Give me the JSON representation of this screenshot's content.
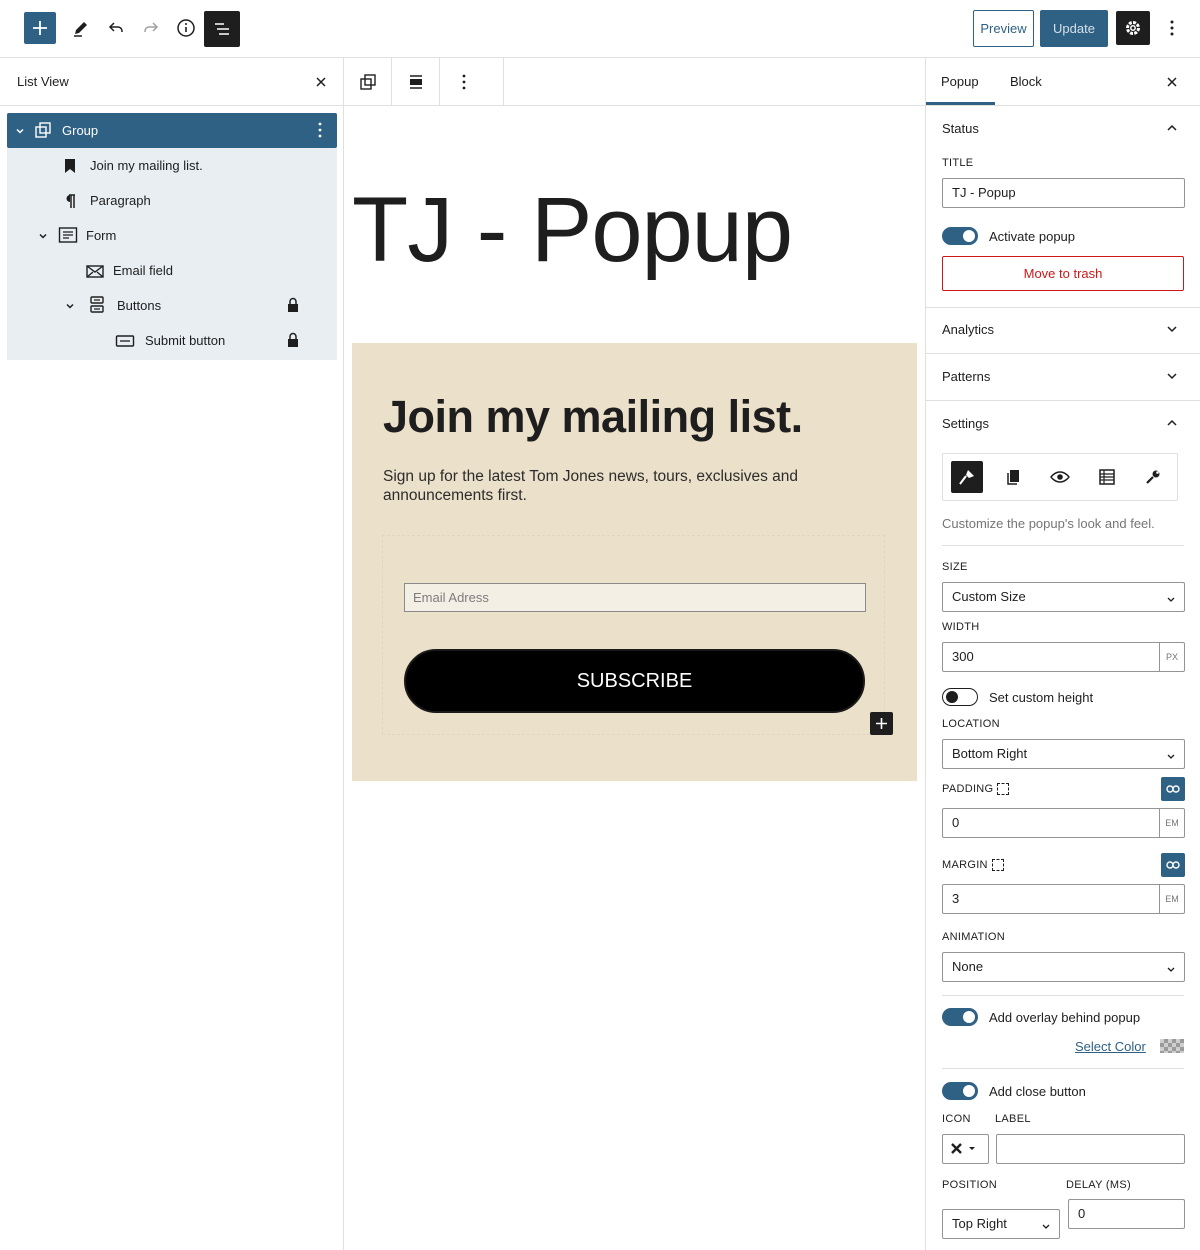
{
  "toolbar": {
    "preview_label": "Preview",
    "update_label": "Update"
  },
  "list_view": {
    "title": "List View",
    "items": [
      {
        "label": "Group",
        "icon": "group-icon",
        "locked": false
      },
      {
        "label": "Join my mailing list.",
        "icon": "bookmark-icon",
        "locked": false
      },
      {
        "label": "Paragraph",
        "icon": "paragraph-icon",
        "locked": false
      },
      {
        "label": "Form",
        "icon": "form-icon",
        "locked": false
      },
      {
        "label": "Email field",
        "icon": "envelope-icon",
        "locked": false
      },
      {
        "label": "Buttons",
        "icon": "buttons-icon",
        "locked": true
      },
      {
        "label": "Submit button",
        "icon": "button-icon",
        "locked": true
      }
    ]
  },
  "canvas": {
    "post_title": "TJ - Popup",
    "heading": "Join my mailing list.",
    "paragraph": "Sign up for the latest Tom Jones news, tours, exclusives and announcements first.",
    "email_placeholder": "Email Adress",
    "button_label": "SUBSCRIBE",
    "group_bg": "#ebe0c9"
  },
  "sidebar": {
    "tabs": [
      "Popup",
      "Block"
    ],
    "status": {
      "title": "Status",
      "title_label": "TITLE",
      "title_value": "TJ - Popup",
      "activate_label": "Activate popup",
      "activate_on": true,
      "trash_label": "Move to trash"
    },
    "analytics_title": "Analytics",
    "patterns_title": "Patterns",
    "settings": {
      "title": "Settings",
      "description": "Customize the popup's look and feel.",
      "size_label": "SIZE",
      "size_value": "Custom Size",
      "width_label": "WIDTH",
      "width_value": "300",
      "width_unit": "PX",
      "custom_height_label": "Set custom height",
      "custom_height_on": false,
      "location_label": "LOCATION",
      "location_value": "Bottom Right",
      "padding_label": "PADDING",
      "padding_value": "0",
      "padding_unit": "EM",
      "margin_label": "MARGIN",
      "margin_value": "3",
      "margin_unit": "EM",
      "animation_label": "ANIMATION",
      "animation_value": "None",
      "overlay_label": "Add overlay behind popup",
      "overlay_on": true,
      "select_color_label": "Select Color",
      "close_button_label": "Add close button",
      "close_button_on": true,
      "icon_label": "ICON",
      "label_label": "LABEL",
      "label_value": "",
      "position_label": "POSITION",
      "position_value": "Top Right",
      "delay_label": "DELAY (MS)",
      "delay_value": "0"
    }
  },
  "colors": {
    "accent": "#2f6185",
    "danger": "#cc1818"
  }
}
